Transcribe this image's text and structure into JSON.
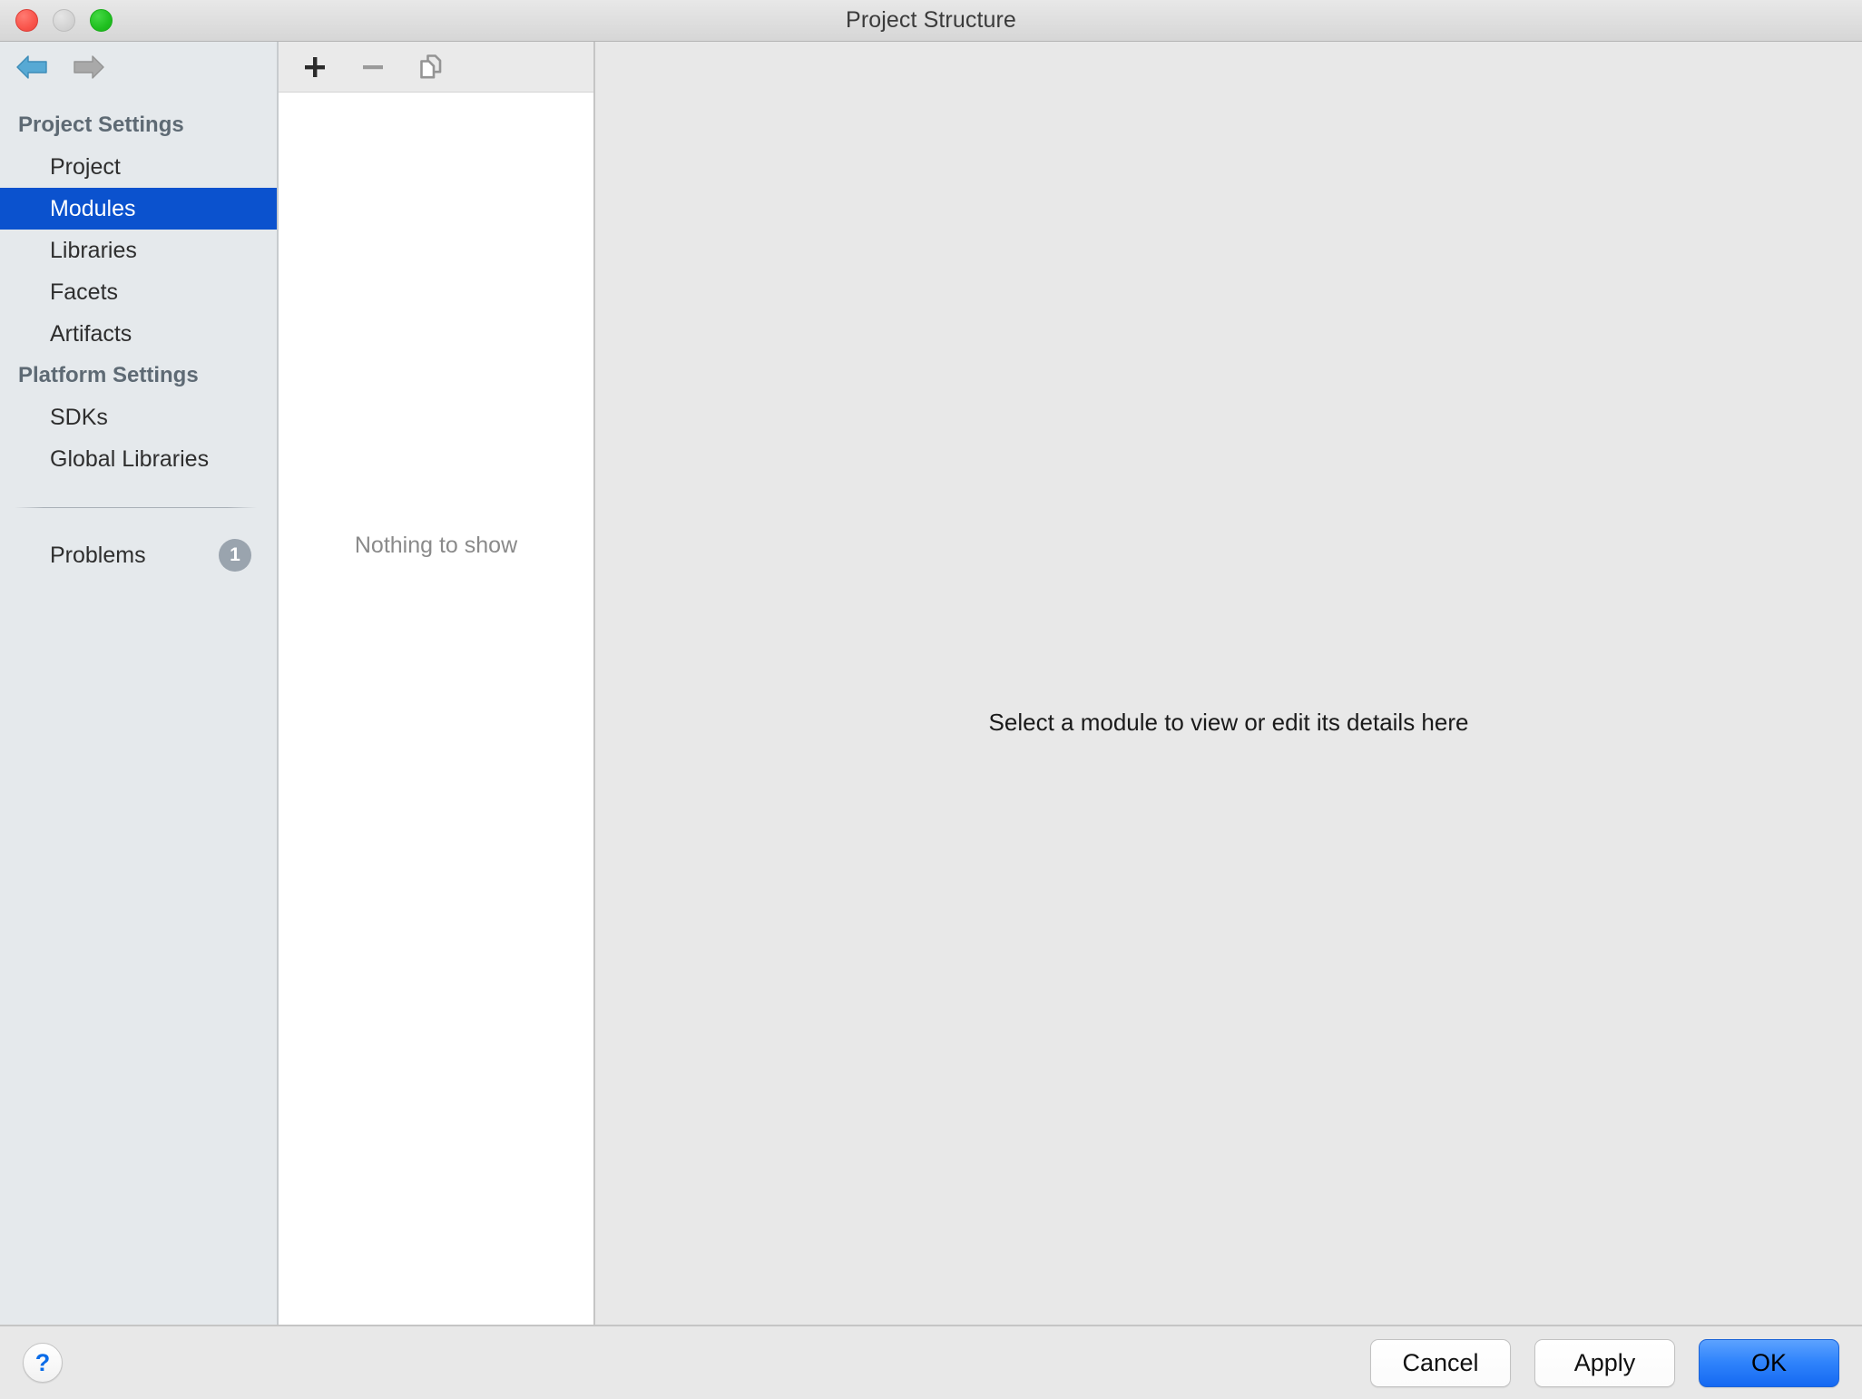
{
  "window": {
    "title": "Project Structure",
    "traffic_lights": [
      "close",
      "minimize",
      "zoom"
    ]
  },
  "sidebar": {
    "nav": {
      "back_icon": "arrow-left-icon",
      "forward_icon": "arrow-right-icon",
      "back_color": "#4ba3cf",
      "forward_color": "#a0a0a0"
    },
    "groups": [
      {
        "header": "Project Settings",
        "items": [
          {
            "label": "Project",
            "selected": false
          },
          {
            "label": "Modules",
            "selected": true
          },
          {
            "label": "Libraries",
            "selected": false
          },
          {
            "label": "Facets",
            "selected": false
          },
          {
            "label": "Artifacts",
            "selected": false
          }
        ]
      },
      {
        "header": "Platform Settings",
        "items": [
          {
            "label": "SDKs",
            "selected": false
          },
          {
            "label": "Global Libraries",
            "selected": false
          }
        ]
      }
    ],
    "problems": {
      "label": "Problems",
      "count": "1"
    },
    "selection_color": "#0b52ce"
  },
  "middle_panel": {
    "toolbar": [
      {
        "name": "add-button",
        "icon": "plus-icon",
        "enabled": true
      },
      {
        "name": "remove-button",
        "icon": "minus-icon",
        "enabled": false
      },
      {
        "name": "copy-button",
        "icon": "copy-icon",
        "enabled": true
      }
    ],
    "empty_text": "Nothing to show"
  },
  "detail_panel": {
    "placeholder_text": "Select a module to view or edit its details here"
  },
  "footer": {
    "help_label": "?",
    "buttons": [
      {
        "label": "Cancel",
        "style": "plain"
      },
      {
        "label": "Apply",
        "style": "plain"
      },
      {
        "label": "OK",
        "style": "primary"
      }
    ],
    "primary_color": "#2f83fb"
  }
}
